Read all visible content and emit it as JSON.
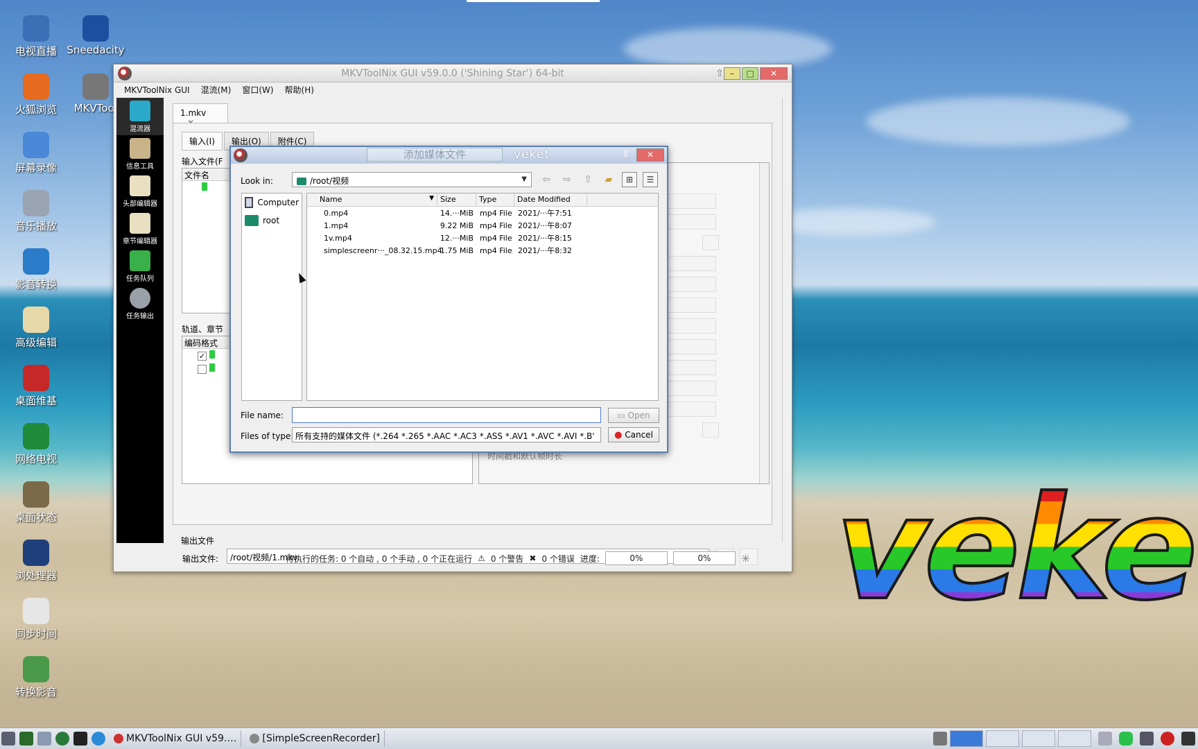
{
  "desktop": {
    "icons": [
      {
        "label": "电视直播",
        "icon": "tv-icon",
        "color": "#3b6fb6"
      },
      {
        "label": "Sneedacity",
        "icon": "headphones-icon",
        "color": "#1d4fa0"
      },
      {
        "label": "火狐浏览",
        "icon": "firefox-icon",
        "color": "#e66a1f"
      },
      {
        "label": "MKVToo·",
        "icon": "mkvtoolnix-icon",
        "color": "#777777"
      },
      {
        "label": "屏幕录像",
        "icon": "screen-record-icon",
        "color": "#4a89d8"
      },
      {
        "label": "音乐播放",
        "icon": "speaker-icon",
        "color": "#9aa4b2"
      },
      {
        "label": "影音转换",
        "icon": "convert-icon",
        "color": "#2a7bc8"
      },
      {
        "label": "高级编辑",
        "icon": "editor-icon",
        "color": "#e8d9a8"
      },
      {
        "label": "桌面维基",
        "icon": "wiki-icon",
        "color": "#c62828"
      },
      {
        "label": "网络电视",
        "icon": "play-icon",
        "color": "#1f8a3a"
      },
      {
        "label": "桌面状态",
        "icon": "coin-icon",
        "color": "#7a6a4a"
      },
      {
        "label": "浏处理器",
        "icon": "processor-icon",
        "color": "#1f3f7a"
      },
      {
        "label": "同步时间",
        "icon": "calendar-icon",
        "color": "#e6e6e6"
      },
      {
        "label": "转换影音",
        "icon": "film-convert-icon",
        "color": "#4a9a4a"
      }
    ],
    "logo_text": "veket"
  },
  "main_window": {
    "title": "MKVToolNix GUI v59.0.0 ('Shining Star') 64-bit",
    "menu": [
      "MKVToolNix GUI",
      "混流(M)",
      "窗口(W)",
      "帮助(H)"
    ],
    "sidebar": [
      "混流器",
      "信息工具",
      "头部编辑器",
      "章节编辑器",
      "任务队列",
      "任务输出"
    ],
    "doc_tab": "1.mkv",
    "sub_tabs": [
      "输入(I)",
      "输出(O)",
      "附件(C)"
    ],
    "input_files_label": "输入文件(F",
    "files_col": "文件名",
    "tracks_label": "轨道、章节",
    "codec_col": "编码格式",
    "timestamps_label": "时间戳和默认帧时长",
    "output_section": "输出文件",
    "output_label": "输出文件:",
    "output_path": "/root/视频/1.mkv",
    "status": {
      "pending": "待执行的任务: 0 个自动 , 0 个手动 , 0 个正在运行",
      "warnings": "0 个警告",
      "errors": "0 个错误",
      "progress_label": "进度:",
      "progress1": "0%",
      "progress2": "0%"
    }
  },
  "dialog": {
    "title": "添加媒体文件",
    "brand": "veket",
    "look_in_label": "Look in:",
    "look_in_value": "/root/视频",
    "places": [
      "Computer",
      "root"
    ],
    "columns": [
      "Name",
      "Size",
      "Type",
      "Date Modified"
    ],
    "files": [
      {
        "name": "0.mp4",
        "size": "14.···MiB",
        "type": "mp4 File",
        "date": "2021/···午7:51"
      },
      {
        "name": "1.mp4",
        "size": "9.22 MiB",
        "type": "mp4 File",
        "date": "2021/···午8:07"
      },
      {
        "name": "1v.mp4",
        "size": "12.···MiB",
        "type": "mp4 File",
        "date": "2021/···午8:15"
      },
      {
        "name": "simplescreenr···_08.32.15.mp4",
        "size": "1.75 MiB",
        "type": "mp4 File",
        "date": "2021/···午8:32"
      }
    ],
    "file_name_label": "File name:",
    "file_name_value": "",
    "open_button": "Open",
    "files_of_type_label": "Files of type:",
    "files_of_type_value": "所有支持的媒体文件 (*.264 *.265 *.AAC *.AC3 *.ASS *.AV1 *.AVC *.AVI *.B'",
    "cancel_button": "Cancel"
  },
  "taskbar": {
    "tasks": [
      "MKVToolNix GUI v59.…",
      "[SimpleScreenRecorder]"
    ]
  }
}
